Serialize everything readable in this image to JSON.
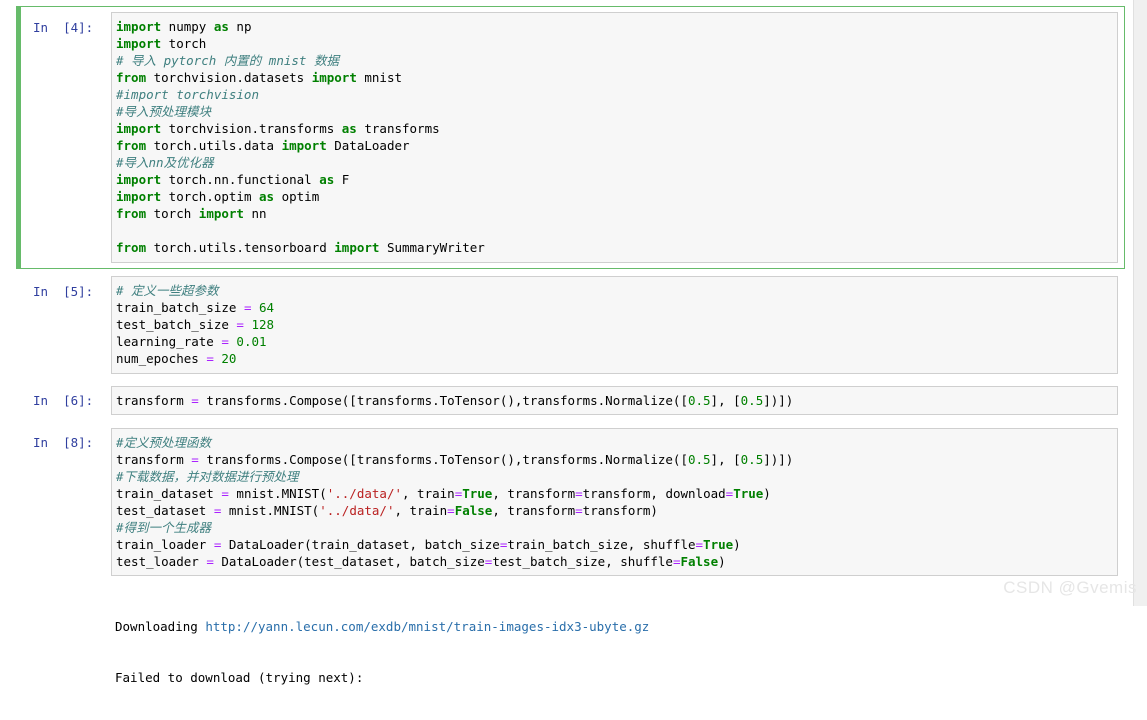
{
  "cells": [
    {
      "prompt": "In  [4]:",
      "selected": true,
      "lines": [
        [
          [
            "kw",
            "import"
          ],
          [
            "t",
            " numpy "
          ],
          [
            "kw",
            "as"
          ],
          [
            "t",
            " np"
          ]
        ],
        [
          [
            "kw",
            "import"
          ],
          [
            "t",
            " torch"
          ]
        ],
        [
          [
            "cm",
            "# 导入 pytorch 内置的 mnist 数据"
          ]
        ],
        [
          [
            "kw",
            "from"
          ],
          [
            "t",
            " torchvision.datasets "
          ],
          [
            "kw",
            "import"
          ],
          [
            "t",
            " mnist"
          ]
        ],
        [
          [
            "cm",
            "#import torchvision"
          ]
        ],
        [
          [
            "cm",
            "#导入预处理模块"
          ]
        ],
        [
          [
            "kw",
            "import"
          ],
          [
            "t",
            " torchvision.transforms "
          ],
          [
            "kw",
            "as"
          ],
          [
            "t",
            " transforms"
          ]
        ],
        [
          [
            "kw",
            "from"
          ],
          [
            "t",
            " torch.utils.data "
          ],
          [
            "kw",
            "import"
          ],
          [
            "t",
            " DataLoader"
          ]
        ],
        [
          [
            "cm",
            "#导入nn及优化器"
          ]
        ],
        [
          [
            "kw",
            "import"
          ],
          [
            "t",
            " torch.nn.functional "
          ],
          [
            "kw",
            "as"
          ],
          [
            "t",
            " F"
          ]
        ],
        [
          [
            "kw",
            "import"
          ],
          [
            "t",
            " torch.optim "
          ],
          [
            "kw",
            "as"
          ],
          [
            "t",
            " optim"
          ]
        ],
        [
          [
            "kw",
            "from"
          ],
          [
            "t",
            " torch "
          ],
          [
            "kw",
            "import"
          ],
          [
            "t",
            " nn"
          ]
        ],
        [
          [
            "t",
            ""
          ]
        ],
        [
          [
            "kw",
            "from"
          ],
          [
            "t",
            " torch.utils.tensorboard "
          ],
          [
            "kw",
            "import"
          ],
          [
            "t",
            " SummaryWriter"
          ]
        ]
      ]
    },
    {
      "prompt": "In  [5]:",
      "selected": false,
      "lines": [
        [
          [
            "cm",
            "# 定义一些超参数"
          ]
        ],
        [
          [
            "t",
            "train_batch_size "
          ],
          [
            "op",
            "="
          ],
          [
            "t",
            " "
          ],
          [
            "num",
            "64"
          ]
        ],
        [
          [
            "t",
            "test_batch_size "
          ],
          [
            "op",
            "="
          ],
          [
            "t",
            " "
          ],
          [
            "num",
            "128"
          ]
        ],
        [
          [
            "t",
            "learning_rate "
          ],
          [
            "op",
            "="
          ],
          [
            "t",
            " "
          ],
          [
            "num",
            "0.01"
          ]
        ],
        [
          [
            "t",
            "num_epoches "
          ],
          [
            "op",
            "="
          ],
          [
            "t",
            " "
          ],
          [
            "num",
            "20"
          ]
        ]
      ]
    },
    {
      "prompt": "In  [6]:",
      "selected": false,
      "lines": [
        [
          [
            "t",
            "transform "
          ],
          [
            "op",
            "="
          ],
          [
            "t",
            " transforms.Compose([transforms.ToTensor(),transforms.Normalize(["
          ],
          [
            "num",
            "0.5"
          ],
          [
            "t",
            "], ["
          ],
          [
            "num",
            "0.5"
          ],
          [
            "t",
            "])])"
          ]
        ]
      ]
    },
    {
      "prompt": "In  [8]:",
      "selected": false,
      "lines": [
        [
          [
            "cm",
            "#定义预处理函数"
          ]
        ],
        [
          [
            "t",
            "transform "
          ],
          [
            "op",
            "="
          ],
          [
            "t",
            " transforms.Compose([transforms.ToTensor(),transforms.Normalize(["
          ],
          [
            "num",
            "0.5"
          ],
          [
            "t",
            "], ["
          ],
          [
            "num",
            "0.5"
          ],
          [
            "t",
            "])])"
          ]
        ],
        [
          [
            "cm",
            "#下载数据，并对数据进行预处理"
          ]
        ],
        [
          [
            "t",
            "train_dataset "
          ],
          [
            "op",
            "="
          ],
          [
            "t",
            " mnist.MNIST("
          ],
          [
            "str",
            "'../data/'"
          ],
          [
            "t",
            ", train"
          ],
          [
            "op",
            "="
          ],
          [
            "bool",
            "True"
          ],
          [
            "t",
            ", transform"
          ],
          [
            "op",
            "="
          ],
          [
            "t",
            "transform, download"
          ],
          [
            "op",
            "="
          ],
          [
            "bool",
            "True"
          ],
          [
            "t",
            ")"
          ]
        ],
        [
          [
            "t",
            "test_dataset "
          ],
          [
            "op",
            "="
          ],
          [
            "t",
            " mnist.MNIST("
          ],
          [
            "str",
            "'../data/'"
          ],
          [
            "t",
            ", train"
          ],
          [
            "op",
            "="
          ],
          [
            "bool",
            "False"
          ],
          [
            "t",
            ", transform"
          ],
          [
            "op",
            "="
          ],
          [
            "t",
            "transform)"
          ]
        ],
        [
          [
            "cm",
            "#得到一个生成器"
          ]
        ],
        [
          [
            "t",
            "train_loader "
          ],
          [
            "op",
            "="
          ],
          [
            "t",
            " DataLoader(train_dataset, batch_size"
          ],
          [
            "op",
            "="
          ],
          [
            "t",
            "train_batch_size, shuffle"
          ],
          [
            "op",
            "="
          ],
          [
            "bool",
            "True"
          ],
          [
            "t",
            ")"
          ]
        ],
        [
          [
            "t",
            "test_loader "
          ],
          [
            "op",
            "="
          ],
          [
            "t",
            " DataLoader(test_dataset, batch_size"
          ],
          [
            "op",
            "="
          ],
          [
            "t",
            "test_batch_size, shuffle"
          ],
          [
            "op",
            "="
          ],
          [
            "bool",
            "False"
          ],
          [
            "t",
            ")"
          ]
        ]
      ]
    }
  ],
  "output": {
    "downloading_label": "Downloading ",
    "url": "http://yann.lecun.com/exdb/mnist/train-images-idx3-ubyte.gz",
    "next_line": "Failed to download (trying next):"
  },
  "watermark": "CSDN @Gvemis"
}
